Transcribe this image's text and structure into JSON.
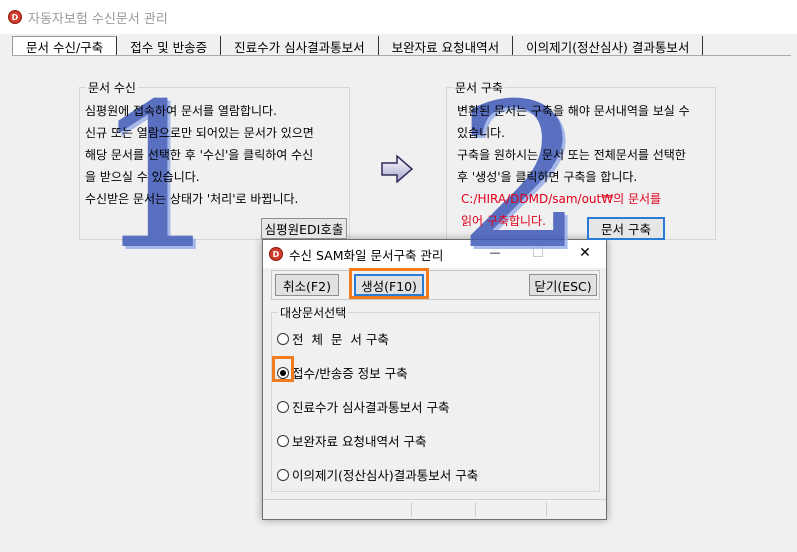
{
  "window": {
    "title": "자동자보험 수신문서 관리",
    "icon": "app-logo-icon"
  },
  "tabs": [
    {
      "label": "문서 수신/구축",
      "active": true
    },
    {
      "label": "접수 및 반송증"
    },
    {
      "label": "진료수가 심사결과통보서"
    },
    {
      "label": "보완자료 요청내역서"
    },
    {
      "label": "이의제기(정산심사) 결과통보서"
    }
  ],
  "receive": {
    "title": "문서 수신",
    "big_number": "1",
    "lines": [
      "심평원에 접속하여 문서를 열람합니다.",
      "신규 또는 열람으로만 되어있는 문서가 있으면",
      "해당 문서를 선택한 후 '수신'을 클릭하여 수신",
      "을 받으실 수 있습니다.",
      "수신받은 문서는 상태가 '처리'로 바뀝니다."
    ],
    "button": "심평원EDI호출"
  },
  "build": {
    "title": "문서 구축",
    "big_number": "2",
    "lines": [
      "변환된 문서는 구축을 해야 문서내역을 보실 수",
      "있습니다.",
      "구축을 원하시는 문서 또는 전체문서를 선택한",
      "후 '생성'을 클릭하면 구축을 합니다."
    ],
    "red_lines": [
      "C:/HIRA/DDMD/sam/out₩의 문서를",
      "읽어 구축합니다."
    ],
    "button": "문서 구축"
  },
  "dialog": {
    "title": "수신 SAM화일 문서구축 관리",
    "minimize": "—",
    "maximize": "☐",
    "close": "✕",
    "cancel": "취소(F2)",
    "generate": "생성(F10)",
    "close_btn": "닫기(ESC)",
    "group_title": "대상문서선택",
    "options": [
      {
        "label": "전  체  문  서 구축",
        "checked": false
      },
      {
        "label": "접수/반송증 정보 구축",
        "checked": true
      },
      {
        "label": "진료수가 심사결과통보서 구축",
        "checked": false
      },
      {
        "label": "보완자료 요청내역서 구축",
        "checked": false
      },
      {
        "label": "이의제기(정산심사)결과통보서 구축",
        "checked": false
      }
    ]
  },
  "colors": {
    "highlight": "#f27b20",
    "numeral": "#3f59b8",
    "warning_text": "#e0001b"
  }
}
